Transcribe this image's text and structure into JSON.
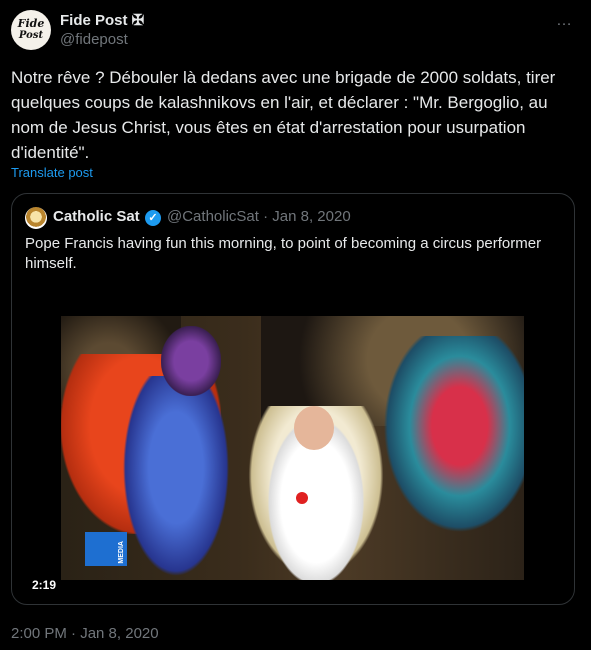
{
  "author": {
    "avatar_text_line1": "Fide",
    "avatar_text_line2": "Post",
    "name": "Fide Post ✠",
    "handle": "@fidepost"
  },
  "menu": {
    "more_icon": "…"
  },
  "post": {
    "text": "Notre rêve ? Débouler là dedans avec une brigade de 2000 soldats, tirer quelques coups de kalashnikovs en l'air, et déclarer : \"Mr. Bergoglio, au nom de Jesus Christ, vous êtes en état d'arrestation pour usurpation d'identité\".",
    "translate_label": "Translate post",
    "timestamp": "2:00 PM · Jan 8, 2020"
  },
  "quoted": {
    "name": "Catholic Sat",
    "verified_icon": "✓",
    "handle_date": "@CatholicSat · Jan 8, 2020",
    "text": "Pope Francis having fun this morning, to point of becoming a circus performer himself.",
    "video_duration": "2:19",
    "video_badge": "MEDIA"
  },
  "colors": {
    "background": "#000000",
    "text": "#e7e9ea",
    "muted": "#71767b",
    "link": "#1d9bf0",
    "border": "#2f3336"
  }
}
